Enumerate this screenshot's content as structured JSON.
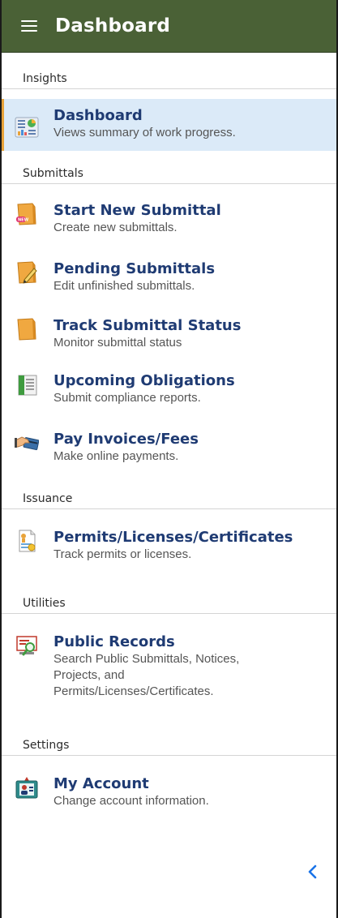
{
  "header": {
    "title": "Dashboard",
    "menu_icon": "hamburger-menu-icon"
  },
  "sections": [
    {
      "label": "Insights"
    },
    {
      "label": "Submittals"
    },
    {
      "label": "Issuance"
    },
    {
      "label": "Utilities"
    },
    {
      "label": "Settings"
    }
  ],
  "items": [
    {
      "title": "Dashboard",
      "desc": "Views summary of work progress.",
      "icon": "dashboard-chart-icon",
      "active": true
    },
    {
      "title": "Start New Submittal",
      "desc": "Create new submittals.",
      "icon": "new-folder-icon"
    },
    {
      "title": "Pending Submittals",
      "desc": "Edit unfinished submittals.",
      "icon": "edit-folder-icon"
    },
    {
      "title": "Track Submittal Status",
      "desc": "Monitor submittal status",
      "icon": "folder-icon"
    },
    {
      "title": "Upcoming Obligations",
      "desc": "Submit compliance reports.",
      "icon": "report-list-icon"
    },
    {
      "title": "Pay Invoices/Fees",
      "desc": "Make online payments.",
      "icon": "payment-card-icon"
    },
    {
      "title": "Permits/Licenses/Certificates",
      "desc": "Track permits or licenses.",
      "icon": "permit-document-icon"
    },
    {
      "title": "Public Records",
      "desc": [
        "Search Public Submittals, Notices,",
        "Projects, and",
        "Permits/Licenses/Certificates."
      ],
      "icon": "search-records-icon"
    },
    {
      "title": "My Account",
      "desc": "Change account information.",
      "icon": "account-icon"
    }
  ],
  "footer": {
    "collapse_icon": "chevron-left-icon"
  },
  "colors": {
    "header_bg": "#4a6136",
    "active_bg": "#dbeaf8",
    "active_border": "#e8a33a",
    "title_text": "#1f3b73",
    "accent_blue": "#1a73e8"
  }
}
